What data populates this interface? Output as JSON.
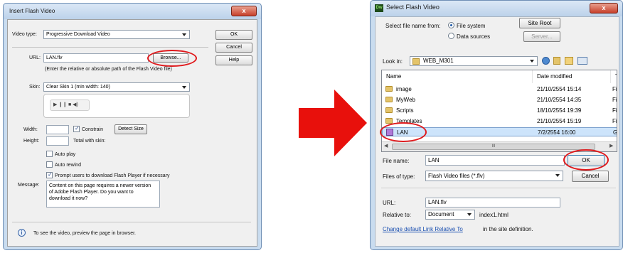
{
  "dialog1": {
    "title": "Insert Flash Video",
    "close": "x",
    "video_type_label": "Video type:",
    "video_type_value": "Progressive Download Video",
    "ok": "OK",
    "cancel": "Cancel",
    "help": "Help",
    "url_label": "URL:",
    "url_value": "LAN.flv",
    "browse": "Browse...",
    "url_hint": "(Enter the relative or absolute path of the Flash Video file)",
    "skin_label": "Skin:",
    "skin_value": "Clear Skin 1 (min width: 140)",
    "player_controls": "▶  ❙❙  ■  ◀)",
    "width_label": "Width:",
    "constrain": "Constrain",
    "detect_size": "Detect Size",
    "height_label": "Height:",
    "total_skin": "Total with skin:",
    "auto_play": "Auto play",
    "auto_rewind": "Auto rewind",
    "prompt": "Prompt users to download Flash Player if necessary",
    "message_label": "Message:",
    "message_value": "Content on this page requires a newer version of Adobe Flash Player. Do you want to download it now?",
    "info": "To see the video, preview the page in browser."
  },
  "dialog2": {
    "title": "Select Flash Video",
    "app_badge": "Dw",
    "close": "x",
    "select_from": "Select file name from:",
    "file_system": "File system",
    "data_sources": "Data sources",
    "site_root": "Site Root",
    "server": "Server...",
    "look_in_label": "Look in:",
    "look_in_value": "WEB_M301",
    "col_name": "Name",
    "col_date": "Date modified",
    "col_type": "Ty",
    "rows": [
      {
        "name": "image",
        "date": "21/10/2554 15:14",
        "type": "Fi"
      },
      {
        "name": "MyWeb",
        "date": "21/10/2554 14:35",
        "type": "Fi"
      },
      {
        "name": "Scripts",
        "date": "18/10/2554 19:39",
        "type": "Fi"
      },
      {
        "name": "Templates",
        "date": "21/10/2554 15:19",
        "type": "Fi"
      },
      {
        "name": "LAN",
        "date": "7/2/2554 16:00",
        "type": "G"
      }
    ],
    "scroll_marker": "III",
    "file_name_label": "File name:",
    "file_name_value": "LAN",
    "ok": "OK",
    "files_type_label": "Files of type:",
    "files_type_value": "Flash Video files (*.flv)",
    "cancel": "Cancel",
    "url_label": "URL:",
    "url_value": "LAN.flv",
    "relative_label": "Relative to:",
    "relative_value": "Document",
    "relative_file": "index1.html",
    "link_text": "Change default Link Relative To",
    "link_suffix": " in the site definition."
  },
  "colors": {
    "arrow": "#e8100c",
    "highlight": "#e0191c"
  }
}
